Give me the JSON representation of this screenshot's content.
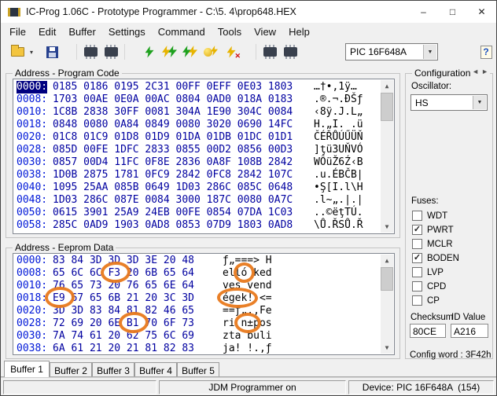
{
  "window": {
    "title": "IC-Prog 1.06C - Prototype Programmer - C:\\5. 4\\prop648.HEX"
  },
  "icons": {
    "minimize": "–",
    "maximize": "□",
    "close": "✕",
    "caret": "▼",
    "caret_small": "▾",
    "scroll_up": "▲",
    "scroll_down": "▼",
    "prev": "◄",
    "next": "►",
    "help": "?"
  },
  "menu": {
    "items": [
      "File",
      "Edit",
      "Buffer",
      "Settings",
      "Command",
      "Tools",
      "View",
      "Help"
    ]
  },
  "toolbar": {
    "device_value": "PIC 16F648A"
  },
  "program_code": {
    "caption": "Address - Program Code",
    "rows": [
      {
        "addr": "0000:",
        "hex": "0185 0186 0195 2C31 00FF 0EFF 0E03 1803",
        "ascii": "…†•,1ÿ…"
      },
      {
        "addr": "0008:",
        "hex": "1703 00AE 0E0A 00AC 0804 0AD0 018A 0183",
        "ascii": ".®.¬.ĐŠƒ"
      },
      {
        "addr": "0010:",
        "hex": "1C8B 2838 30FF 0081 304A 1E90 304C 0084",
        "ascii": "‹8ÿ.J.L„"
      },
      {
        "addr": "0018:",
        "hex": "0848 0080 0A84 0849 0080 3020 0690 14FC",
        "ascii": "H.„I. .ü"
      },
      {
        "addr": "0020:",
        "hex": "01C8 01C9 01D8 01D9 01DA 01DB 01DC 01D1",
        "ascii": "ČÉŘŮÚŰÜŇ"
      },
      {
        "addr": "0028:",
        "hex": "085D 00FE 1DFC 2833 0855 00D2 0856 00D3",
        "ascii": "]ţü3UŇVÓ"
      },
      {
        "addr": "0030:",
        "hex": "0857 00D4 11FC 0F8E 2836 0A8F 108B 2842",
        "ascii": "WÔüŽ6Ź‹B"
      },
      {
        "addr": "0038:",
        "hex": "1D0B 2875 1781 0FC9 2842 0FC8 2842 107C",
        "ascii": ".u.ÉBČB|"
      },
      {
        "addr": "0040:",
        "hex": "1095 25AA 085B 0649 1D03 286C 085C 0648",
        "ascii": "•Ş[I.l\\H"
      },
      {
        "addr": "0048:",
        "hex": "1D03 286C 087E 0084 3000 187C 0080 0A7C",
        "ascii": ".l~„.|.|"
      },
      {
        "addr": "0050:",
        "hex": "0615 3901 25A9 24EB 00FE 0854 07DA 1C03",
        "ascii": "..©ëţTÚ."
      },
      {
        "addr": "0058:",
        "hex": "285C 0AD9 1903 0AD8 0853 07D9 1803 0AD8",
        "ascii": "\\Ů.ŘSŮ.Ř"
      }
    ]
  },
  "eeprom": {
    "caption": "Address - Eeprom Data",
    "rows": [
      {
        "addr": "0000:",
        "hex": "83 84 3D 3D 3D 3E 20 48",
        "ascii": "ƒ„===> H"
      },
      {
        "addr": "0008:",
        "hex": "65 6C 6C F3 20 6B 65 64",
        "ascii": "elló ked"
      },
      {
        "addr": "0010:",
        "hex": "76 65 73 20 76 65 6E 64",
        "ascii": "ves vend"
      },
      {
        "addr": "0018:",
        "hex": "E9 67 65 6B 21 20 3C 3D",
        "ascii": "égek! <="
      },
      {
        "addr": "0020:",
        "hex": "3D 3D 83 84 81 82 46 65",
        "ascii": "==ƒ„.‚Fe"
      },
      {
        "addr": "0028:",
        "hex": "72 69 20 6E B1 70 6F 73",
        "ascii": "ri n±pos"
      },
      {
        "addr": "0030:",
        "hex": "7A 74 61 20 62 75 6C 69",
        "ascii": "zta buli"
      },
      {
        "addr": "0038:",
        "hex": "6A 61 21 20 21 81 82 83",
        "ascii": "ja! !.‚ƒ"
      }
    ]
  },
  "config": {
    "caption": "Configuration",
    "oscillator_label": "Oscillator:",
    "oscillator_value": "HS",
    "fuses_label": "Fuses:",
    "fuses": [
      {
        "label": "WDT",
        "mark": ""
      },
      {
        "label": "PWRT",
        "mark": "✓"
      },
      {
        "label": "MCLR",
        "mark": ""
      },
      {
        "label": "BODEN",
        "mark": "✓"
      },
      {
        "label": "LVP",
        "mark": ""
      },
      {
        "label": "CPD",
        "mark": ""
      },
      {
        "label": "CP",
        "mark": ""
      }
    ],
    "checksum_label": "Checksum",
    "checksum_value": "80CE",
    "id_label": "ID Value",
    "id_value": "A216",
    "config_word": "Config word : 3F42h"
  },
  "tabs": [
    "Buffer 1",
    "Buffer 2",
    "Buffer 3",
    "Buffer 4",
    "Buffer 5"
  ],
  "status": {
    "programmer": "JDM Programmer on",
    "device": "Device: PIC 16F648A  (154)"
  },
  "annotations": {
    "color": "#e8791c"
  }
}
